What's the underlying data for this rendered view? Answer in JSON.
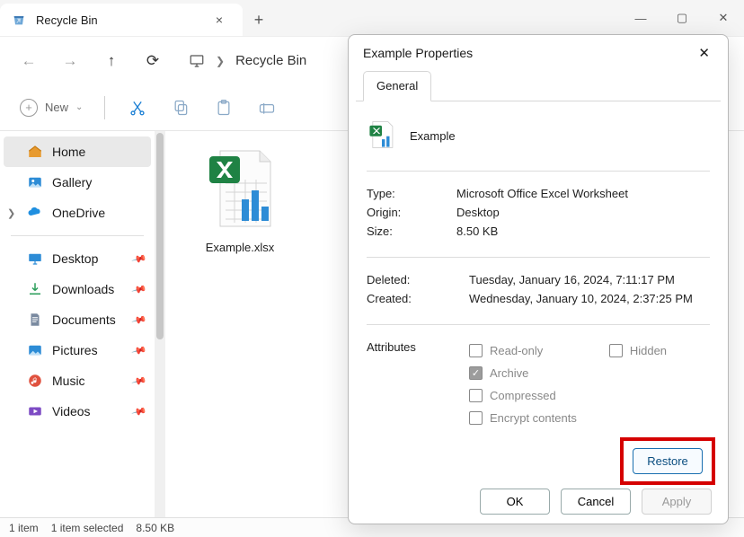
{
  "titlebar": {
    "tab_title": "Recycle Bin",
    "tab_close": "×",
    "new_tab": "+"
  },
  "nav": {
    "address_icon": "monitor",
    "address": "Recycle Bin"
  },
  "toolbar": {
    "new_label": "New"
  },
  "sidebar": {
    "home": "Home",
    "gallery": "Gallery",
    "onedrive": "OneDrive",
    "desktop": "Desktop",
    "downloads": "Downloads",
    "documents": "Documents",
    "pictures": "Pictures",
    "music": "Music",
    "videos": "Videos"
  },
  "files": {
    "items": [
      {
        "label": "Example.xlsx"
      }
    ]
  },
  "statusbar": {
    "count": "1 item",
    "selected": "1 item selected",
    "size": "8.50 KB"
  },
  "dialog": {
    "title": "Example Properties",
    "tab_general": "General",
    "filename": "Example",
    "rows": {
      "type_k": "Type:",
      "type_v": "Microsoft Office Excel Worksheet",
      "origin_k": "Origin:",
      "origin_v": "Desktop",
      "size_k": "Size:",
      "size_v": "8.50 KB",
      "deleted_k": "Deleted:",
      "deleted_v": "Tuesday, January 16, 2024, 7:11:17 PM",
      "created_k": "Created:",
      "created_v": "Wednesday, January 10, 2024, 2:37:25 PM",
      "attributes_k": "Attributes"
    },
    "attrs": {
      "readonly": "Read-only",
      "hidden": "Hidden",
      "archive": "Archive",
      "compressed": "Compressed",
      "encrypt": "Encrypt contents"
    },
    "buttons": {
      "restore": "Restore",
      "ok": "OK",
      "cancel": "Cancel",
      "apply": "Apply"
    }
  }
}
